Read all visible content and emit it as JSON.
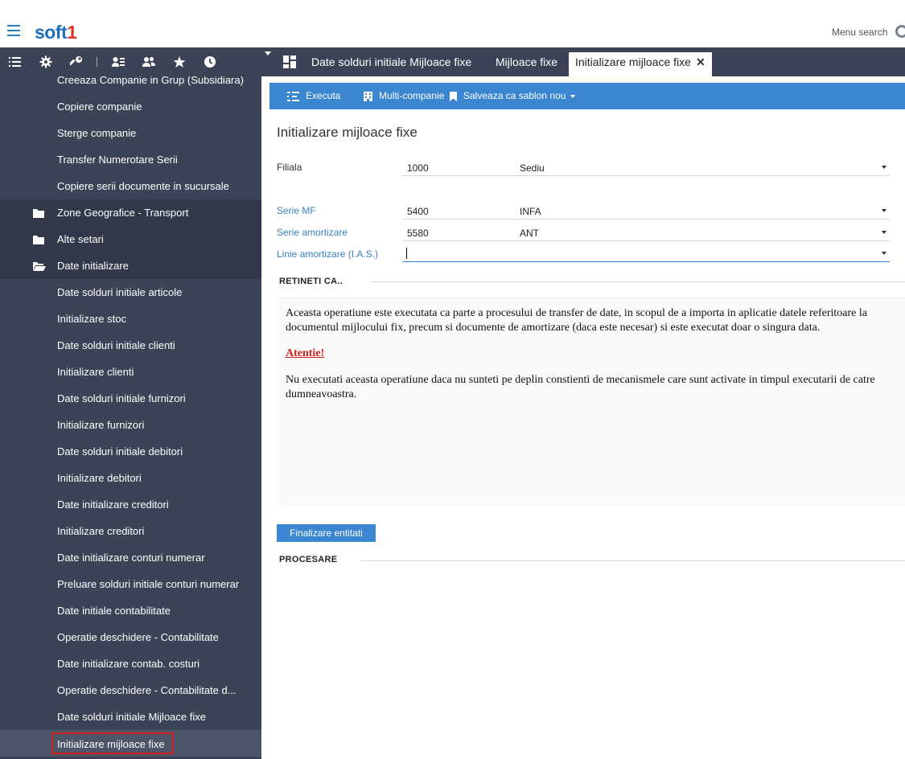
{
  "header": {
    "logo_main": "soft",
    "logo_accent": "1",
    "menu_search_label": "Menu search"
  },
  "sidebar": {
    "toolbar_icons": [
      "list-icon",
      "gear-icon",
      "wrench-icon",
      "user-list-icon",
      "users-icon",
      "star-icon",
      "clock-icon"
    ],
    "items": [
      {
        "label": "Creeaza Companie in Grup (Subsidiara)",
        "type": "child"
      },
      {
        "label": "Copiere companie",
        "type": "child"
      },
      {
        "label": "Sterge companie",
        "type": "child"
      },
      {
        "label": "Transfer Numerotare Serii",
        "type": "child"
      },
      {
        "label": "Copiere serii documente in sucursale",
        "type": "child"
      },
      {
        "label": "Zone Geografice - Transport",
        "type": "folder"
      },
      {
        "label": "Alte setari",
        "type": "folder"
      },
      {
        "label": "Date initializare",
        "type": "folder-open"
      },
      {
        "label": "Date solduri initiale articole",
        "type": "child"
      },
      {
        "label": "Initializare stoc",
        "type": "child"
      },
      {
        "label": "Date solduri initiale clienti",
        "type": "child"
      },
      {
        "label": "Initializare clienti",
        "type": "child"
      },
      {
        "label": "Date solduri initiale furnizori",
        "type": "child"
      },
      {
        "label": "Initializare furnizori",
        "type": "child"
      },
      {
        "label": "Date solduri initiale debitori",
        "type": "child"
      },
      {
        "label": "Initializare debitori",
        "type": "child"
      },
      {
        "label": "Date initializare creditori",
        "type": "child"
      },
      {
        "label": "Initializare creditori",
        "type": "child"
      },
      {
        "label": "Date initializare conturi numerar",
        "type": "child"
      },
      {
        "label": "Preluare solduri initiale conturi numerar",
        "type": "child"
      },
      {
        "label": "Date initiale contabilitate",
        "type": "child"
      },
      {
        "label": "Operatie deschidere - Contabilitate",
        "type": "child"
      },
      {
        "label": "Date initializare contab. costuri",
        "type": "child"
      },
      {
        "label": "Operatie deschidere - Contabilitate d...",
        "type": "child"
      },
      {
        "label": "Date solduri initiale Mijloace fixe",
        "type": "child"
      },
      {
        "label": "Initializare mijloace fixe",
        "type": "active"
      }
    ]
  },
  "tabs": [
    {
      "label": "Date solduri initiale Mijloace fixe"
    },
    {
      "label": "Mijloace fixe"
    },
    {
      "label": "Initializare mijloace fixe",
      "active": true
    }
  ],
  "tab_close_glyph": "✕",
  "actions": {
    "execute": "Executa",
    "multi_company": "Multi-companie",
    "save_template": "Salveaza ca sablon nou"
  },
  "form": {
    "title": "Initializare mijloace fixe",
    "fields": [
      {
        "label": "Filiala",
        "code": "1000",
        "name": "Sediu"
      },
      {
        "label": "Serie MF",
        "code": "5400",
        "name": "INFA"
      },
      {
        "label": "Serie amortizare",
        "code": "5580",
        "name": "ANT"
      },
      {
        "label": "Linie amortizare (I.A.S.)",
        "code": "",
        "name": ""
      }
    ]
  },
  "notice": {
    "heading": "RETINETI CA..",
    "para1_line1": "Aceasta operatiune este executata ca parte a procesului de transfer de date, in scopul de a importa in aplicatie datele referitoare la",
    "para1_line2": "documentul mijlocului fix, precum si documente de amortizare (daca este necesar) si este executat doar o singura data.",
    "warning": "Atentie!",
    "para2_line1": "Nu executati aceasta operatiune daca nu sunteti pe deplin constienti de mecanismele care sunt activate in timpul executarii de catre",
    "para2_line2": "dumneavoastra."
  },
  "finish_button": "Finalizare entitati",
  "processing_heading": "PROCESARE",
  "colors": {
    "sidebar_bg": "#3c4356",
    "accent_blue": "#3a86d0",
    "active_outline": "#d0201c"
  }
}
